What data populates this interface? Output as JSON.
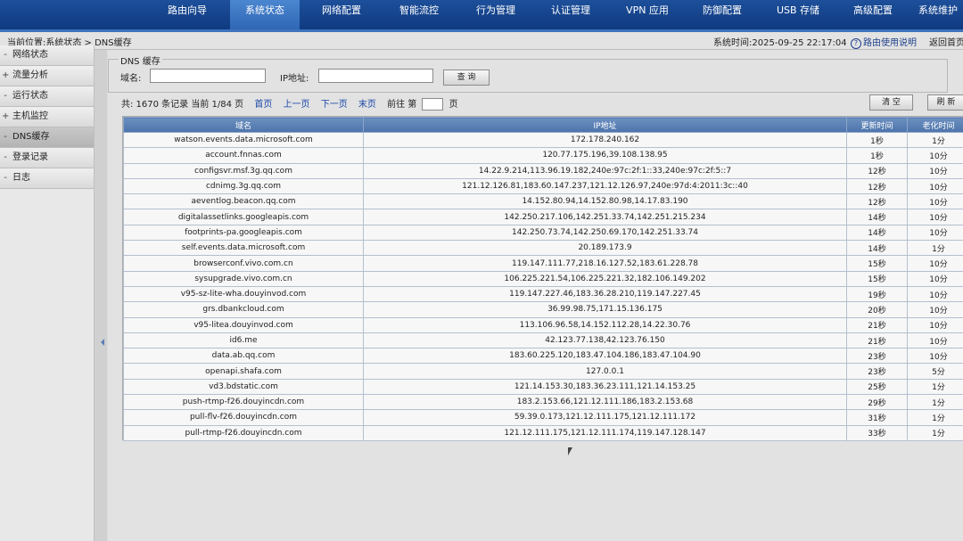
{
  "nav": {
    "items": [
      {
        "label": "路由向导",
        "active": false
      },
      {
        "label": "系统状态",
        "active": true
      },
      {
        "label": "网络配置",
        "active": false
      },
      {
        "label": "智能流控",
        "active": false
      },
      {
        "label": "行为管理",
        "active": false
      },
      {
        "label": "认证管理",
        "active": false
      },
      {
        "label": "VPN 应用",
        "active": false
      },
      {
        "label": "防御配置",
        "active": false
      },
      {
        "label": "USB 存储",
        "active": false
      },
      {
        "label": "高级配置",
        "active": false
      },
      {
        "label": "系统维护",
        "active": false
      }
    ]
  },
  "header": {
    "breadcrumb": "当前位置:系统状态 > DNS缓存",
    "system_time": "系统时间:2025-09-25 22:17:04",
    "help": "路由使用说明",
    "back": "返回首页"
  },
  "sidebar": {
    "items": [
      {
        "prefix": "-",
        "label": "网络状态",
        "active": false
      },
      {
        "prefix": "+",
        "label": "流量分析",
        "active": false
      },
      {
        "prefix": "-",
        "label": "运行状态",
        "active": false
      },
      {
        "prefix": "+",
        "label": "主机监控",
        "active": false
      },
      {
        "prefix": "-",
        "label": "DNS缓存",
        "active": true
      },
      {
        "prefix": "-",
        "label": "登录记录",
        "active": false
      },
      {
        "prefix": "-",
        "label": "日志",
        "active": false
      }
    ]
  },
  "search": {
    "legend": "DNS 缓存",
    "domain_label": "域名:",
    "domain_value": "",
    "ip_label": "IP地址:",
    "ip_value": "",
    "query_button": "查 询"
  },
  "pager": {
    "summary": "共: 1670 条记录 当前 1/84 页",
    "first": "首页",
    "prev": "上一页",
    "next": "下一页",
    "last": "末页",
    "goto_prefix": "前往 第",
    "goto_suffix": "页"
  },
  "actions": {
    "clear": "清 空",
    "refresh": "刷 新"
  },
  "table": {
    "columns": [
      "域名",
      "IP地址",
      "更新时间",
      "老化时间"
    ],
    "rows": [
      [
        "watson.events.data.microsoft.com",
        "172.178.240.162",
        "1秒",
        "1分"
      ],
      [
        "account.fnnas.com",
        "120.77.175.196,39.108.138.95",
        "1秒",
        "10分"
      ],
      [
        "configsvr.msf.3g.qq.com",
        "14.22.9.214,113.96.19.182,240e:97c:2f:1::33,240e:97c:2f:5::7",
        "12秒",
        "10分"
      ],
      [
        "cdnimg.3g.qq.com",
        "121.12.126.81,183.60.147.237,121.12.126.97,240e:97d:4:2011:3c::40",
        "12秒",
        "10分"
      ],
      [
        "aeventlog.beacon.qq.com",
        "14.152.80.94,14.152.80.98,14.17.83.190",
        "12秒",
        "10分"
      ],
      [
        "digitalassetlinks.googleapis.com",
        "142.250.217.106,142.251.33.74,142.251.215.234",
        "14秒",
        "10分"
      ],
      [
        "footprints-pa.googleapis.com",
        "142.250.73.74,142.250.69.170,142.251.33.74",
        "14秒",
        "10分"
      ],
      [
        "self.events.data.microsoft.com",
        "20.189.173.9",
        "14秒",
        "1分"
      ],
      [
        "browserconf.vivo.com.cn",
        "119.147.111.77,218.16.127.52,183.61.228.78",
        "15秒",
        "10分"
      ],
      [
        "sysupgrade.vivo.com.cn",
        "106.225.221.54,106.225.221.32,182.106.149.202",
        "15秒",
        "10分"
      ],
      [
        "v95-sz-lite-wha.douyinvod.com",
        "119.147.227.46,183.36.28.210,119.147.227.45",
        "19秒",
        "10分"
      ],
      [
        "grs.dbankcloud.com",
        "36.99.98.75,171.15.136.175",
        "20秒",
        "10分"
      ],
      [
        "v95-litea.douyinvod.com",
        "113.106.96.58,14.152.112.28,14.22.30.76",
        "21秒",
        "10分"
      ],
      [
        "id6.me",
        "42.123.77.138,42.123.76.150",
        "21秒",
        "10分"
      ],
      [
        "data.ab.qq.com",
        "183.60.225.120,183.47.104.186,183.47.104.90",
        "23秒",
        "10分"
      ],
      [
        "openapi.shafa.com",
        "127.0.0.1",
        "23秒",
        "5分"
      ],
      [
        "vd3.bdstatic.com",
        "121.14.153.30,183.36.23.111,121.14.153.25",
        "25秒",
        "1分"
      ],
      [
        "push-rtmp-f26.douyincdn.com",
        "183.2.153.66,121.12.111.186,183.2.153.68",
        "29秒",
        "1分"
      ],
      [
        "pull-flv-f26.douyincdn.com",
        "59.39.0.173,121.12.111.175,121.12.111.172",
        "31秒",
        "1分"
      ],
      [
        "pull-rtmp-f26.douyincdn.com",
        "121.12.111.175,121.12.111.174,119.147.128.147",
        "33秒",
        "1分"
      ]
    ]
  }
}
